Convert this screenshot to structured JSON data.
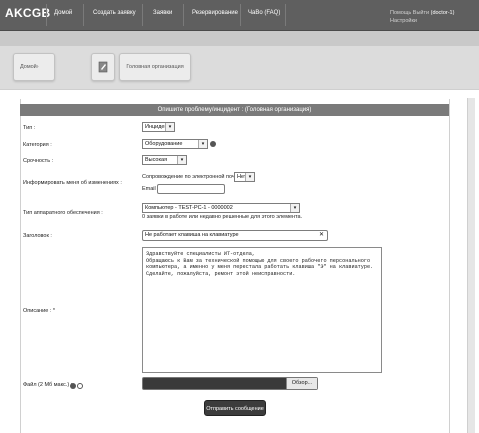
{
  "header": {
    "logo": "AKCGB",
    "nav": [
      {
        "label": "Домой"
      },
      {
        "label": "Создать заявку"
      },
      {
        "label": "Заявки"
      },
      {
        "label": "Резервирование"
      },
      {
        "label": "ЧаВо (FAQ)"
      }
    ],
    "user": {
      "help": "Помощь",
      "logout": "Выйти",
      "username": "(doctor-1)",
      "settings": "Настройки"
    }
  },
  "toolbar": {
    "home_label": "Домой›",
    "org_label": "Головная организация"
  },
  "form": {
    "title": "Опишите проблему/инцидент :  (Головная организация)",
    "type": {
      "label": "Тип :",
      "value": "Инцидент"
    },
    "category": {
      "label": "Категория :",
      "value": "Оборудование"
    },
    "urgency": {
      "label": "Срочность :",
      "value": "Высокая"
    },
    "notify": {
      "label": "Информировать меня об изменениях :",
      "email_follow_label": "Сопровождение по электронной почте :",
      "email_follow_value": "Нет",
      "email_label": "Email :",
      "email_value": ""
    },
    "hardware": {
      "label": "Тип аппаратного обеспечения :",
      "value": "Компьютер - TEST-PC-1 - 0000002",
      "note": "0 заявки в работе или недавно решенные для этого элемента."
    },
    "subject": {
      "label": "Заголовок :",
      "value": "Не работает клавиша на клавиатуре"
    },
    "description": {
      "label": "Описание : *",
      "lines": [
        "Здравствуйте специалисты ИТ-отдела,",
        "Обращаюсь к Вам за технической помощью для своего рабочего персонального",
        "компьютера, а именно у меня перестала работать клавиша \"Э\" на клавиатуре.",
        "Сделайте, пожалуйста, ремонт этой неисправности."
      ]
    },
    "file": {
      "label": "Файл (2 Мб макс.) :",
      "browse": "Обзор..."
    },
    "submit": "Отправить сообщение"
  }
}
